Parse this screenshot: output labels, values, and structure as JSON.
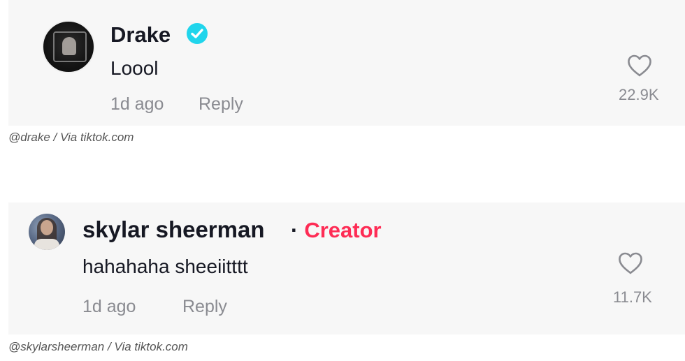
{
  "comments": [
    {
      "username": "Drake",
      "verified": true,
      "text": "Loool",
      "time": "1d ago",
      "reply_label": "Reply",
      "likes": "22.9K",
      "avatar_icon": "avatar-photo",
      "credit": "@drake / Via tiktok.com"
    },
    {
      "username": "skylar sheerman",
      "separator": "·",
      "tag": "Creator",
      "text": "hahahaha sheeiitttt",
      "time": "1d ago",
      "reply_label": "Reply",
      "likes": "11.7K",
      "avatar_icon": "avatar-photo",
      "credit": "@skylarsheerman / Via tiktok.com"
    }
  ],
  "colors": {
    "card_bg": "#f7f7f7",
    "text_primary": "#161823",
    "text_secondary": "#8a8b91",
    "creator_accent": "#fe2c55",
    "verified_badge": "#20d5ec"
  },
  "icons": {
    "verified": "verified-check-icon",
    "like": "heart-icon"
  }
}
